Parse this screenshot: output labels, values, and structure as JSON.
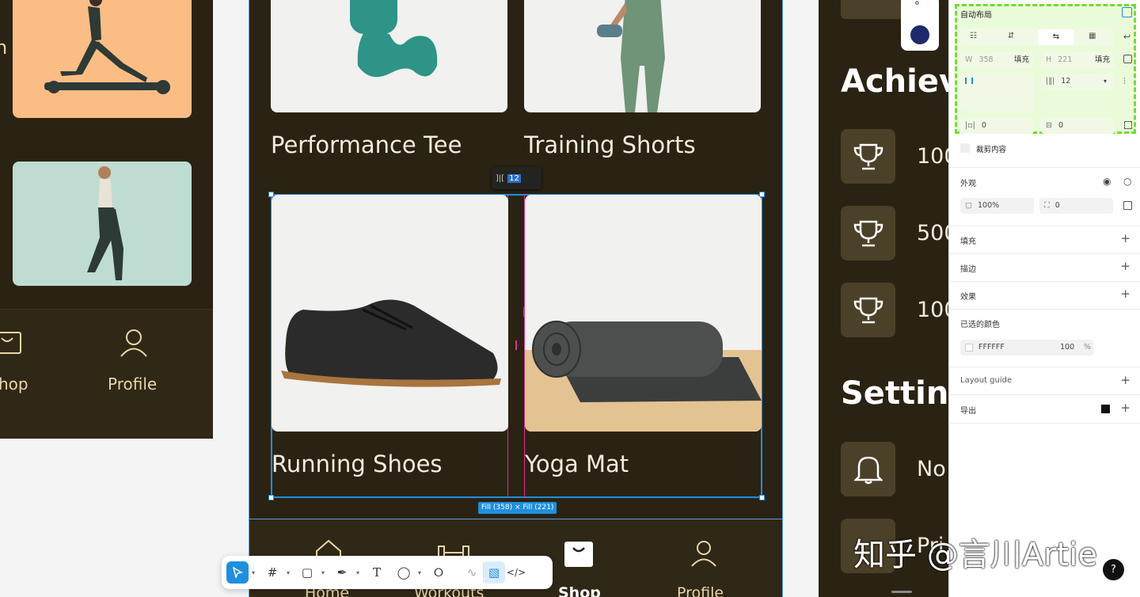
{
  "left_frame": {
    "nav_shop_label": "hop",
    "nav_profile_label": "Profile"
  },
  "center_frame": {
    "product_1": "Performance Tee",
    "product_2": "Training Shorts",
    "product_3": "Running Shoes",
    "product_4": "Yoga Mat",
    "gap_tooltip_icon": "]|[",
    "gap_tooltip_value": "12",
    "gap_marker": "12",
    "size_badge": "Fill (358) × Fill (221)",
    "nav": {
      "home": "Home",
      "workouts": "Workouts",
      "shop": "Shop",
      "profile": "Profile"
    }
  },
  "right_frame": {
    "achievements_heading": "Achieve",
    "achievement_1": "100",
    "achievement_2": "500",
    "achievement_3": "100",
    "settings_heading": "Setting",
    "setting_1": "No",
    "setting_2": "Pri"
  },
  "inspector": {
    "auto_layout_title": "自动布局",
    "w_label": "W",
    "w_value": "358",
    "w_mode": "填充",
    "h_label": "H",
    "h_value": "221",
    "h_mode": "填充",
    "gap_value": "12",
    "padding_h": "0",
    "padding_v": "0",
    "clip_content": "裁剪内容",
    "appearance": "外观",
    "opacity": "100%",
    "radius": "0",
    "fill": "填充",
    "stroke": "描边",
    "effect": "效果",
    "selected_colors": "已选的颜色",
    "color_hex": "FFFFFF",
    "color_opacity": "100",
    "percent": "%",
    "layout_guide": "Layout guide",
    "export": "导出"
  },
  "watermark": "知乎 @言川Artie",
  "help": "?",
  "colors": {
    "dark_bg": "#2a2313",
    "gold": "#e8d6a8",
    "selection_blue": "#1e8fe0",
    "guide_pink": "#e0308c",
    "auto_layout_green": "#71e02c"
  }
}
